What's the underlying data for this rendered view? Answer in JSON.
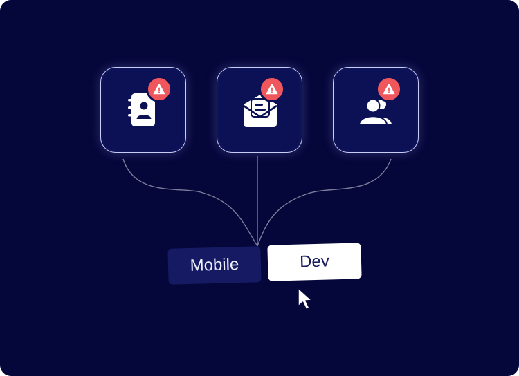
{
  "colors": {
    "background": "#05063a",
    "tile_fill": "#0c1155",
    "tile_border": "#c9cdf6",
    "alert": "#f0575d",
    "connector": "#7b7e9a",
    "selected_chip": "#ffffff",
    "unselected_chip": "#151a63"
  },
  "tiles": [
    {
      "icon": "contact-book-icon",
      "alert": true
    },
    {
      "icon": "open-mail-icon",
      "alert": true
    },
    {
      "icon": "user-group-icon",
      "alert": true
    }
  ],
  "chips": {
    "mobile": {
      "label": "Mobile",
      "selected": false
    },
    "dev": {
      "label": "Dev",
      "selected": true
    }
  },
  "cursor": {
    "icon": "mouse-pointer-icon"
  }
}
